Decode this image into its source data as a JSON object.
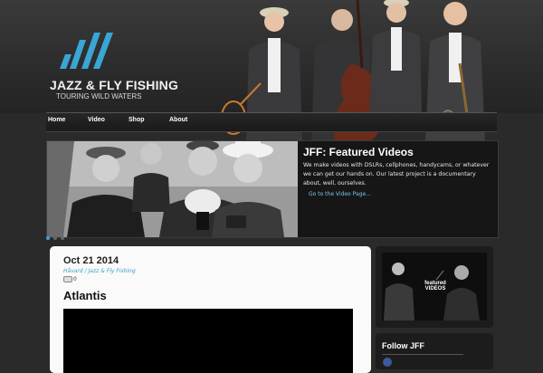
{
  "header": {
    "logo_text": "JAZZ & FLY FISHING",
    "logo_tagline": "TOURING WILD WATERS"
  },
  "nav": {
    "items": [
      {
        "label": "Home"
      },
      {
        "label": "Video"
      },
      {
        "label": "Shop"
      },
      {
        "label": "About"
      }
    ]
  },
  "slider": {
    "title": "JFF: Featured Videos",
    "text": "We make videos with DSLRs, cellphones, handycams, or whatever we can get our hands on. Our latest project is a documentary about, well, ourselves.",
    "link": "Go to the Video Page..."
  },
  "post": {
    "date": "Oct 21 2014",
    "meta": "Håvard / Jazz & Fly Fishing",
    "comments": "0",
    "title": "Atlantis"
  },
  "sidebar": {
    "featured_overlay": "featured VIDEOS",
    "follow_title": "Follow JFF"
  },
  "colors": {
    "accent": "#3aa0c8",
    "logo_blue": "#39a6d6",
    "link": "#7ac8e8"
  }
}
